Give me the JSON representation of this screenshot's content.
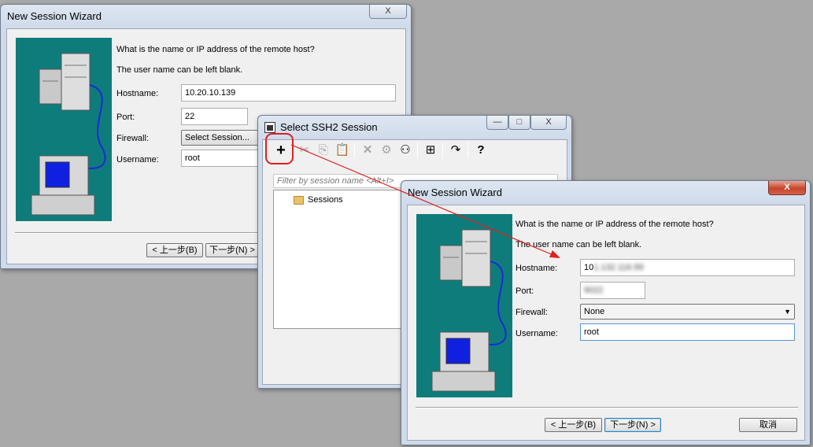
{
  "wizard_back": {
    "title": "New Session Wizard",
    "close_glyph": "X",
    "prompt_line1": "What is the name or IP address of the remote host?",
    "prompt_line2": "The user name can be left blank.",
    "hostname_label": "Hostname:",
    "hostname_value": "10.20.10.139",
    "port_label": "Port:",
    "port_value": "22",
    "firewall_label": "Firewall:",
    "firewall_value": "Select Session...",
    "username_label": "Username:",
    "username_value": "root",
    "back_button": "< 上一步(B)",
    "next_button": "下一步(N) >"
  },
  "select_ssh2": {
    "title": "Select SSH2 Session",
    "minimize_glyph": "—",
    "maximize_glyph": "□",
    "close_glyph": "X",
    "toolbar_icons": [
      "plus-icon",
      "cut-icon",
      "copy-icon",
      "paste-icon",
      "delete-icon",
      "gear-icon",
      "binoculars-icon",
      "new-folder-icon",
      "share-icon",
      "help-icon"
    ],
    "filter_placeholder": "Filter by session name <Alt+I>",
    "tree_root": "Sessions"
  },
  "wizard_front": {
    "title": "New Session Wizard",
    "close_glyph": "X",
    "prompt_line1": "What is the name or IP address of the remote host?",
    "prompt_line2": "The user name can be left blank.",
    "hostname_label": "Hostname:",
    "hostname_value": "10",
    "hostname_value_blurred": "1.132.116.99",
    "port_label": "Port:",
    "port_value_blurred": "9022",
    "firewall_label": "Firewall:",
    "firewall_value": "None",
    "username_label": "Username:",
    "username_value": "root",
    "back_button": "< 上一步(B)",
    "next_button": "下一步(N) >",
    "cancel_button": "取消"
  },
  "annotation": {
    "color": "#e02020"
  }
}
